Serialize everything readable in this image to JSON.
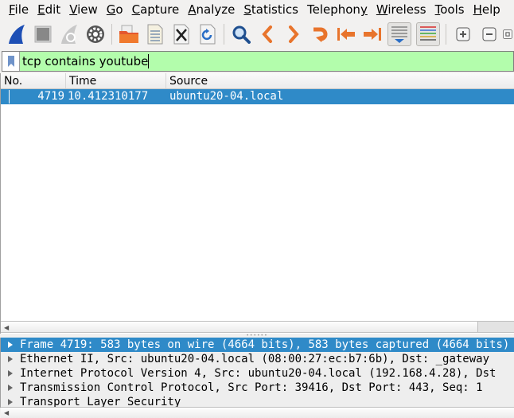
{
  "menubar": {
    "items": [
      {
        "label": "File",
        "mnemonic": "F"
      },
      {
        "label": "Edit",
        "mnemonic": "E"
      },
      {
        "label": "View",
        "mnemonic": "V"
      },
      {
        "label": "Go",
        "mnemonic": "G"
      },
      {
        "label": "Capture",
        "mnemonic": "C"
      },
      {
        "label": "Analyze",
        "mnemonic": "A"
      },
      {
        "label": "Statistics",
        "mnemonic": "S"
      },
      {
        "label": "Telephony",
        "mnemonic": "y"
      },
      {
        "label": "Wireless",
        "mnemonic": "W"
      },
      {
        "label": "Tools",
        "mnemonic": "T"
      },
      {
        "label": "Help",
        "mnemonic": "H"
      }
    ]
  },
  "toolbar": {
    "buttons": [
      "start-capture-icon",
      "stop-capture-icon",
      "restart-capture-icon",
      "capture-options-icon",
      "open-file-icon",
      "save-file-icon",
      "close-file-icon",
      "reload-file-icon",
      "find-packet-icon",
      "go-back-icon",
      "go-forward-icon",
      "go-to-packet-icon",
      "go-first-packet-icon",
      "go-last-packet-icon",
      "autoscroll-icon",
      "colorize-icon",
      "zoom-in-icon",
      "zoom-out-icon",
      "normal-size-icon"
    ]
  },
  "filter": {
    "value": "tcp contains youtube",
    "valid_color": "#b3fdac"
  },
  "packet_list": {
    "columns": [
      "No.",
      "Time",
      "Source"
    ],
    "rows": [
      {
        "no": "4719",
        "time": "10.412310177",
        "source": "ubuntu20-04.local"
      }
    ],
    "selected_color": "#2f8ac8"
  },
  "details": {
    "rows": [
      {
        "text": "Frame 4719: 583 bytes on wire (4664 bits), 583 bytes captured (4664 bits)",
        "selected": true
      },
      {
        "text": "Ethernet II, Src: ubuntu20-04.local (08:00:27:ec:b7:6b), Dst: _gateway",
        "selected": false
      },
      {
        "text": "Internet Protocol Version 4, Src: ubuntu20-04.local (192.168.4.28), Dst",
        "selected": false
      },
      {
        "text": "Transmission Control Protocol, Src Port: 39416, Dst Port: 443, Seq: 1",
        "selected": false
      },
      {
        "text": "Transport Layer Security",
        "selected": false
      }
    ]
  }
}
